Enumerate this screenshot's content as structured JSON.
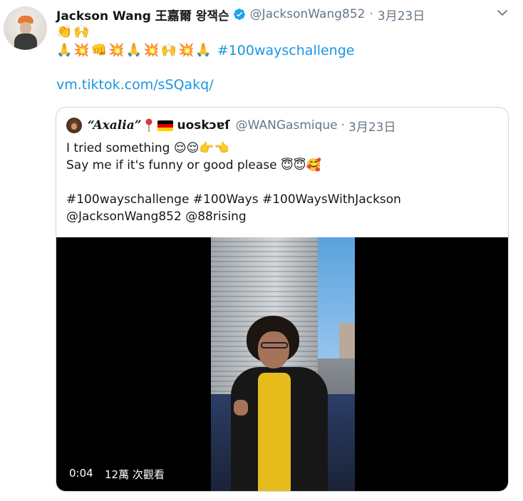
{
  "tweet": {
    "author_name": "Jackson Wang 王嘉爾 왕잭슨",
    "handle": "@JacksonWang852",
    "separator": "·",
    "date": "3月23日",
    "line1_emojis": [
      "👏",
      "🙌"
    ],
    "line2_emojis": [
      "🙏",
      "💥",
      "👊",
      "💥",
      "🙏",
      "💥",
      "🙌",
      "💥",
      "🙏"
    ],
    "line2_hashtag": "#100wayschallenge",
    "link": "vm.tiktok.com/sSQakq/"
  },
  "quote": {
    "author_name": "“Axalia”",
    "author_suffix": "uoskɔɐſ",
    "handle": "@WANGasmique",
    "separator": "·",
    "date": "3月23日",
    "line1_text": "I tried something",
    "line1_emojis": [
      "😌",
      "😌",
      "👉",
      "👈"
    ],
    "line2_text": "Say me if it's funny or good please",
    "line2_emojis": [
      "😇",
      "😇",
      "🥰"
    ],
    "hashtags_line": "#100wayschallenge #100Ways #100WaysWithJackson",
    "mentions_line": "@JacksonWang852 @88rising"
  },
  "video": {
    "time": "0:04",
    "views": "12萬 次觀看"
  },
  "colors": {
    "link": "#1b95e0",
    "verified": "#1da1f2",
    "secondary_text": "#657786",
    "border": "#ccd6dd"
  },
  "icons": {
    "verified": "verified-badge-icon",
    "caret": "chevron-down-icon"
  }
}
